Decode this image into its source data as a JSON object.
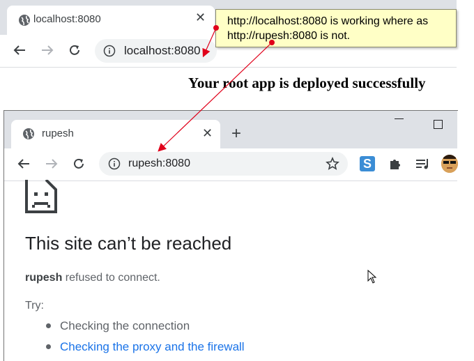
{
  "back_browser": {
    "tab_title": "localhost:8080",
    "url": "localhost:8080",
    "page_text": "Your root app is deployed successfully"
  },
  "callout": {
    "text": "http://localhost:8080 is working where as\nhttp://rupesh:8080 is not."
  },
  "front_browser": {
    "tab_title": "rupesh",
    "url": "rupesh:8080",
    "error": {
      "title": "This site can’t be reached",
      "host": "rupesh",
      "message": " refused to connect.",
      "try_label": "Try:",
      "suggestions": [
        "Checking the connection",
        "Checking the proxy and the firewall"
      ]
    },
    "extension_letter": "S"
  },
  "colors": {
    "callout_bg": "#ffffc6",
    "arrow": "#e0001a",
    "link": "#1a73e8",
    "tabstrip": "#dee1e6"
  }
}
